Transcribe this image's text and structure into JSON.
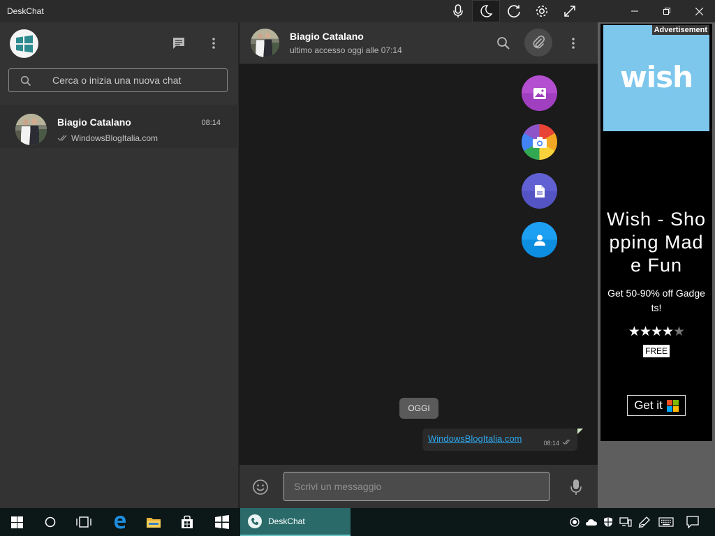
{
  "window": {
    "title": "DeskChat",
    "toolbar_icons": [
      "microphone-icon",
      "moon-icon",
      "refresh-icon",
      "gear-icon",
      "expand-icon"
    ],
    "night_mode_active": true
  },
  "sidebar": {
    "search_placeholder": "Cerca o inizia una nuova chat",
    "chats": [
      {
        "name": "Biagio Catalano",
        "time": "08:14",
        "preview": "WindowsBlogItalia.com"
      }
    ]
  },
  "conversation": {
    "contact_name": "Biagio Catalano",
    "last_seen": "ultimo accesso oggi alle 07:14",
    "attach_menu": [
      "gallery-icon",
      "camera-icon",
      "document-icon",
      "contact-icon"
    ],
    "date_separator": "OGGI",
    "messages": [
      {
        "text": "WindowsBlogItalia.com",
        "time": "08:14",
        "outgoing": true,
        "is_link": true
      }
    ],
    "composer_placeholder": "Scrivi un messaggio"
  },
  "ad": {
    "label": "Advertisement",
    "brand": "wish",
    "title": "Wish - Shopping Made Fun",
    "subtitle": "Get 50-90% off Gadgets!",
    "rating_stars": 4.5,
    "stars_display": "★★★★",
    "price": "FREE",
    "cta": "Get it"
  },
  "taskbar": {
    "active_app": "DeskChat"
  },
  "colors": {
    "window_bg": "#1b1b1b",
    "panel_bg": "#333333",
    "accent_teal": "#2a6b6a",
    "link": "#2da8ee",
    "ad_blue": "#7dc6ec"
  }
}
